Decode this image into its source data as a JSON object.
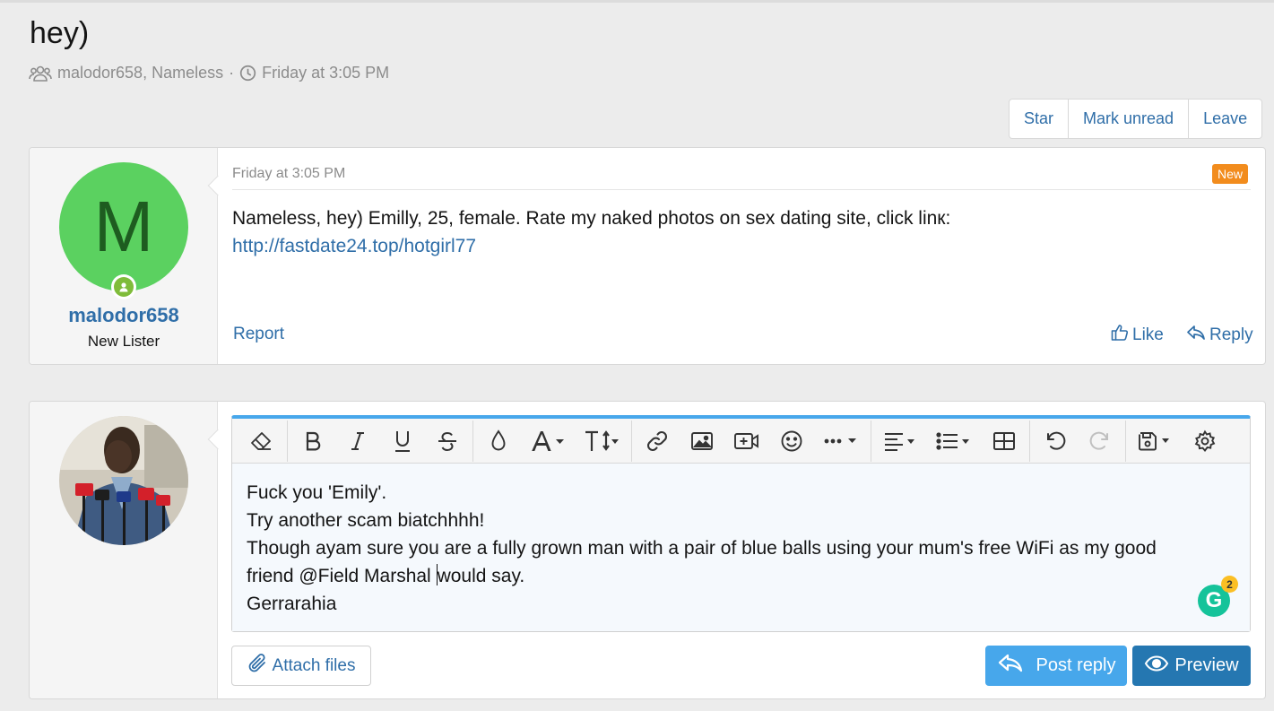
{
  "thread": {
    "title": "hey)",
    "participants": "malodor658, Nameless",
    "separator": "·",
    "date": "Friday at 3:05 PM"
  },
  "actions": {
    "star": "Star",
    "mark_unread": "Mark unread",
    "leave": "Leave"
  },
  "message": {
    "avatar_letter": "M",
    "avatar_color": "#5bd160",
    "username": "malodor658",
    "user_title": "New Lister",
    "date": "Friday at 3:05 PM",
    "badge": "New",
    "body": "Nameless, hey) Emilly, 25, female. Rate my naked photos on sex dating site, click linк:",
    "link": "http://fastdate24.top/hotgirl77",
    "report": "Report",
    "like": "Like",
    "reply": "Reply"
  },
  "editor": {
    "toolbar": [
      "eraser-icon",
      "bold-icon",
      "italic-icon",
      "underline-icon",
      "strikethrough-icon",
      "text-color-icon",
      "font-family-icon",
      "font-size-icon",
      "link-icon",
      "image-icon",
      "video-icon",
      "emoji-icon",
      "more-icon",
      "align-icon",
      "list-icon",
      "table-icon",
      "undo-icon",
      "redo-icon",
      "drafts-icon",
      "settings-icon"
    ],
    "lines": [
      "Fuck you 'Emily'.",
      "Try another scam biatchhhh!",
      "Though ayam sure you are a fully grown man with a pair of blue balls using your mum's free WiFi as my good",
      "friend @Field Marshal ",
      "would say.",
      "Gerrarahia"
    ],
    "grammarly_count": "2"
  },
  "buttons": {
    "attach": "Attach files",
    "post_reply": "Post reply",
    "preview": "Preview"
  },
  "colors": {
    "accent": "#47a7eb",
    "link": "#2f6ea8",
    "primary": "#2577b1",
    "badge": "#f28c1d"
  }
}
